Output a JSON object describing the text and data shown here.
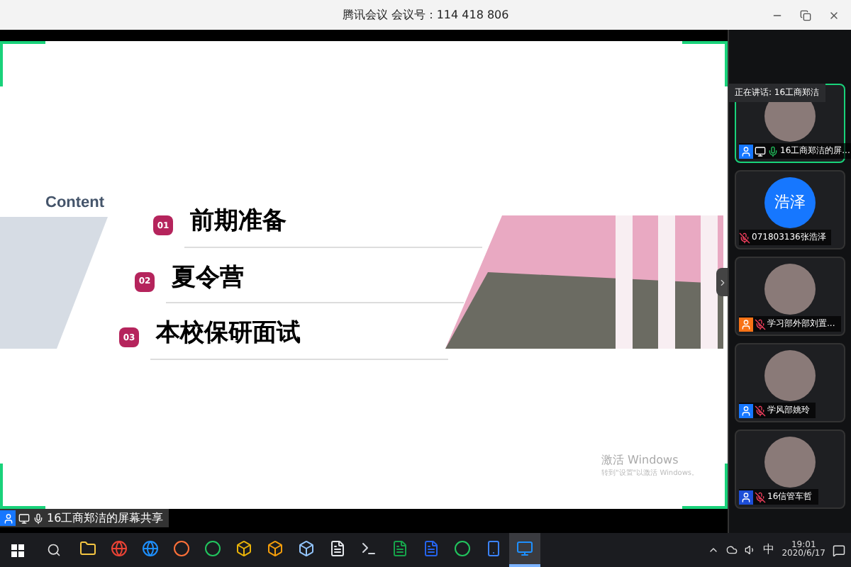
{
  "window": {
    "title": "腾讯会议 会议号：114 418 806"
  },
  "slide": {
    "heading": "Content",
    "items": [
      {
        "number": "01",
        "text": "前期准备"
      },
      {
        "number": "02",
        "text": "夏令营"
      },
      {
        "number": "03",
        "text": "本校保研面试"
      }
    ],
    "watermark": {
      "title": "激活 Windows",
      "subtitle": "转到\"设置\"以激活 Windows。"
    }
  },
  "speaking_banner": "正在讲话: 16工商郑洁",
  "participants": [
    {
      "name": "16工商郑洁的屏...",
      "avatar": {
        "kind": "photo"
      },
      "mic_muted": false,
      "color": "#1677ff",
      "sharing": true,
      "speaking": true
    },
    {
      "name": "071803136张浩泽",
      "avatar": {
        "kind": "initials",
        "text": "浩泽"
      },
      "mic_muted": true,
      "sharing": false,
      "speaking": false
    },
    {
      "name": "学习部外部刘置...",
      "avatar": {
        "kind": "photo"
      },
      "mic_muted": true,
      "color": "#f97316",
      "sharing": false,
      "speaking": false
    },
    {
      "name": "学风部姚玲",
      "avatar": {
        "kind": "photo"
      },
      "mic_muted": true,
      "color": "#1677ff",
      "sharing": false,
      "speaking": false
    },
    {
      "name": "16信管车哲",
      "avatar": {
        "kind": "photo"
      },
      "mic_muted": true,
      "color": "#1d4ed8",
      "sharing": false,
      "speaking": false
    }
  ],
  "share_label": "16工商郑洁的屏幕共享",
  "taskbar": {
    "apps": [
      {
        "kind": "folder",
        "selected": false
      },
      {
        "kind": "chrome",
        "selected": false
      },
      {
        "kind": "edge",
        "selected": false
      },
      {
        "kind": "firefox",
        "selected": false
      },
      {
        "kind": "ring",
        "selected": false
      },
      {
        "kind": "tool",
        "selected": false
      },
      {
        "kind": "box",
        "selected": false
      },
      {
        "kind": "cube",
        "selected": false
      },
      {
        "kind": "doc",
        "selected": false
      },
      {
        "kind": "terminal",
        "selected": false
      },
      {
        "kind": "excel",
        "selected": false
      },
      {
        "kind": "word",
        "selected": false
      },
      {
        "kind": "ring",
        "selected": false
      },
      {
        "kind": "phone",
        "selected": false
      },
      {
        "kind": "meeting",
        "selected": true
      }
    ],
    "ime": "中",
    "time": "19:01",
    "date": "2020/6/17"
  }
}
